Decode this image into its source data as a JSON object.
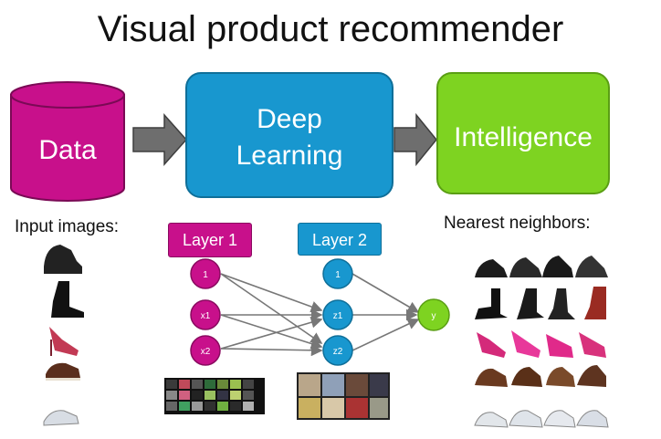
{
  "title": "Visual product recommender",
  "pipeline": {
    "data_label": "Data",
    "deep_learning_line1": "Deep",
    "deep_learning_line2": "Learning",
    "intelligence_label": "Intelligence"
  },
  "colors": {
    "data": "#c8108b",
    "deep_learning": "#1897cf",
    "intelligence": "#7ed321",
    "arrow": "#6e6e6e"
  },
  "input_images_label": "Input images:",
  "nearest_neighbors_label": "Nearest neighbors:",
  "network": {
    "layer1_label": "Layer 1",
    "layer2_label": "Layer 2",
    "layer1_nodes": [
      "1",
      "x1",
      "x2"
    ],
    "layer2_nodes": [
      "1",
      "z1",
      "z2"
    ],
    "output_node": "y"
  }
}
